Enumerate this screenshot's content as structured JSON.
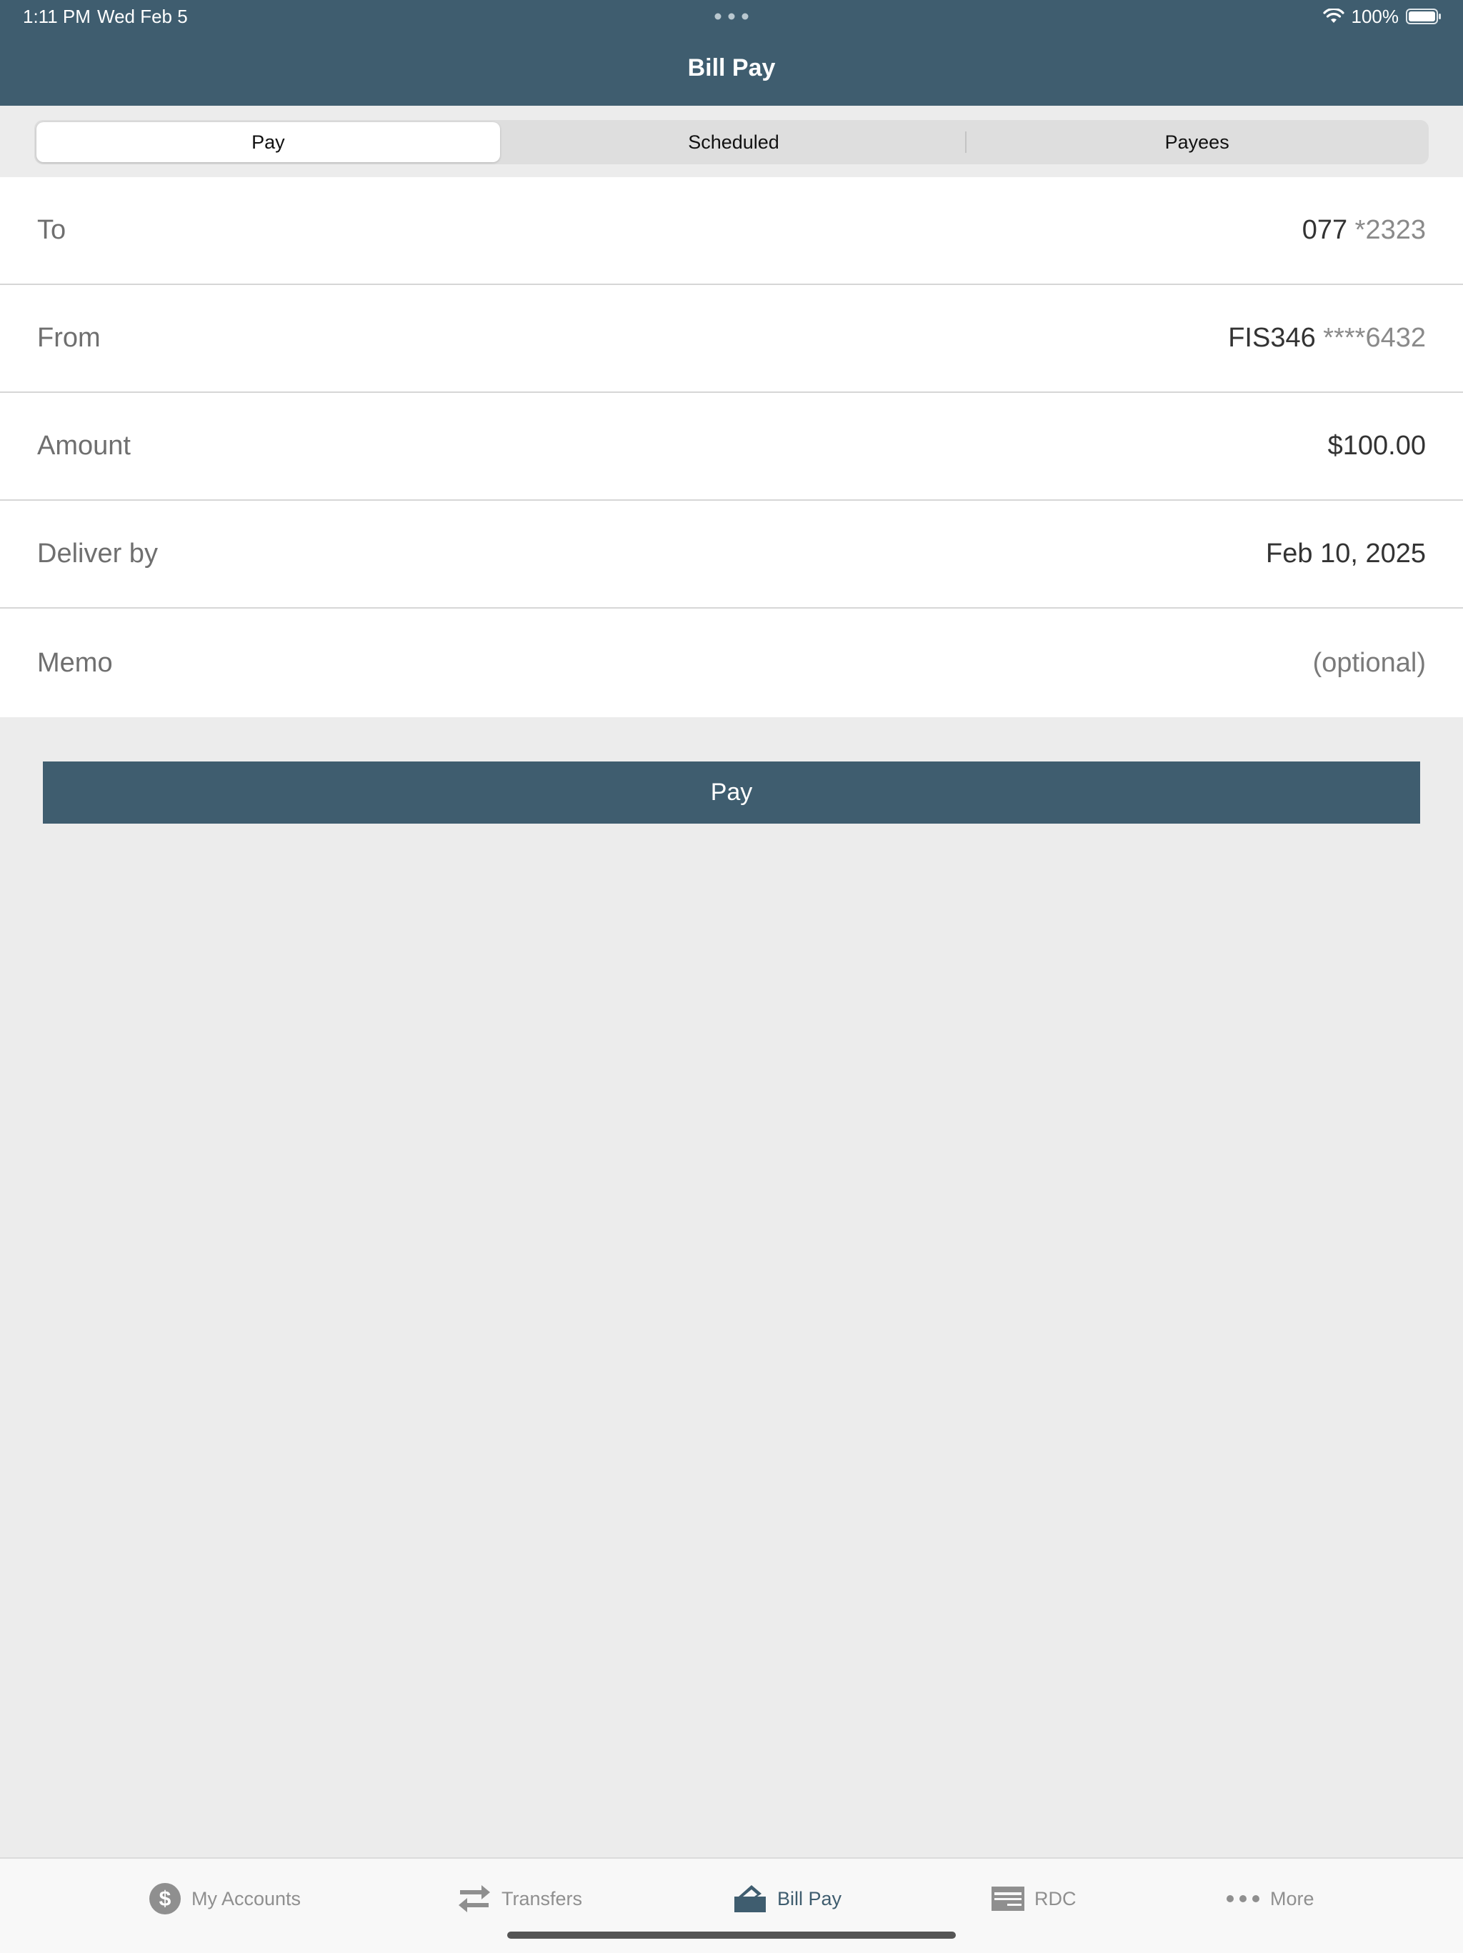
{
  "status_bar": {
    "time": "1:11 PM",
    "date": "Wed Feb 5",
    "battery": "100%"
  },
  "header": {
    "title": "Bill Pay"
  },
  "segments": [
    {
      "label": "Pay",
      "active": true
    },
    {
      "label": "Scheduled",
      "active": false
    },
    {
      "label": "Payees",
      "active": false
    }
  ],
  "form": {
    "to": {
      "label": "To",
      "value_main": "077",
      "value_mask": " *2323"
    },
    "from": {
      "label": "From",
      "value_main": "FIS346",
      "value_mask": " ****6432"
    },
    "amount": {
      "label": "Amount",
      "value": "$100.00"
    },
    "deliver_by": {
      "label": "Deliver by",
      "value": "Feb 10, 2025"
    },
    "memo": {
      "label": "Memo",
      "placeholder": "(optional)"
    }
  },
  "pay_button": {
    "label": "Pay"
  },
  "tabbar": {
    "items": [
      {
        "label": "My Accounts",
        "icon": "dollar-circle-icon"
      },
      {
        "label": "Transfers",
        "icon": "transfer-arrows-icon"
      },
      {
        "label": "Bill Pay",
        "icon": "bill-pay-icon",
        "active": true
      },
      {
        "label": "RDC",
        "icon": "check-icon"
      },
      {
        "label": "More",
        "icon": "more-dots-icon"
      }
    ]
  },
  "colors": {
    "brand": "#3f5d6f",
    "background": "#ececec",
    "inactive_tab": "#8f8f8f"
  }
}
